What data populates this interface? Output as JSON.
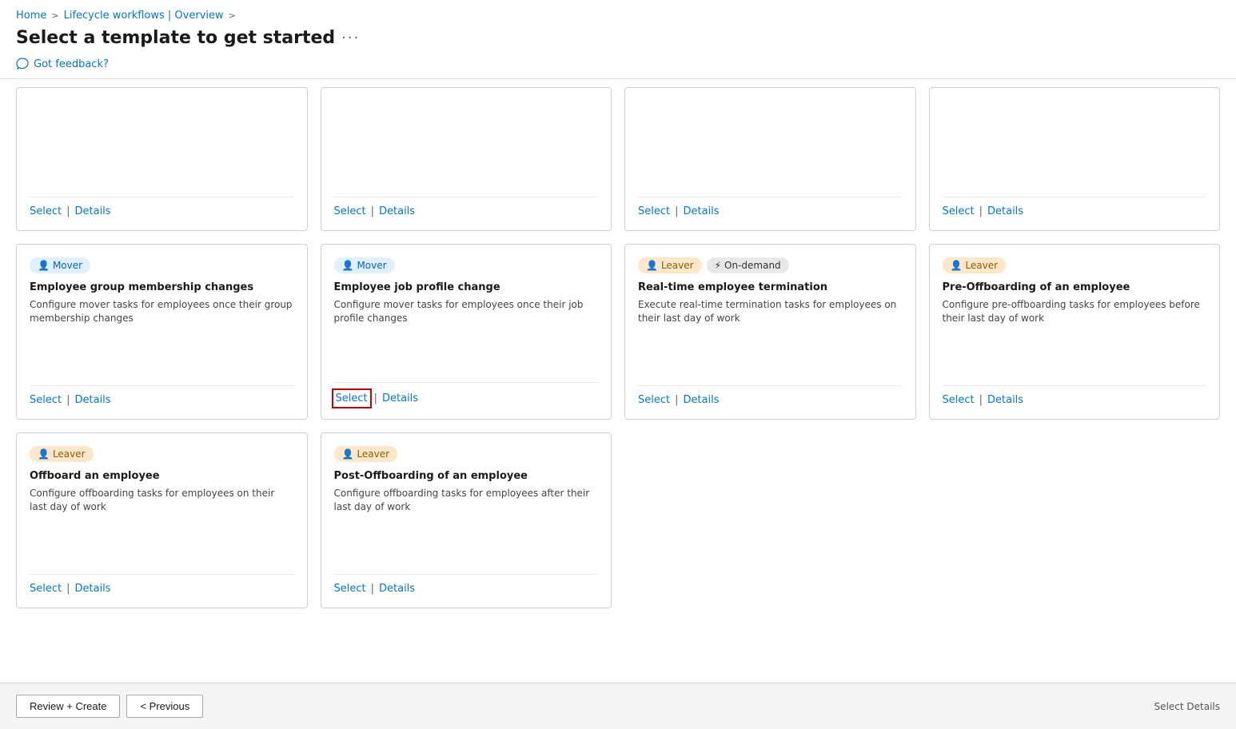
{
  "breadcrumb": {
    "home": "Home",
    "sep1": ">",
    "workflows": "Lifecycle workflows | Overview",
    "sep2": ">"
  },
  "page_title": "Select a template to get started",
  "page_title_more": "···",
  "feedback": "Got feedback?",
  "cards": [
    {
      "id": "card-1",
      "tags": [],
      "title": "",
      "description": "",
      "select_label": "Select",
      "details_label": "Details",
      "is_empty": true
    },
    {
      "id": "card-2",
      "tags": [],
      "title": "",
      "description": "",
      "select_label": "Select",
      "details_label": "Details",
      "is_empty": true
    },
    {
      "id": "card-3",
      "tags": [],
      "title": "",
      "description": "",
      "select_label": "Select",
      "details_label": "Details",
      "is_empty": true
    },
    {
      "id": "card-4",
      "tags": [],
      "title": "",
      "description": "",
      "select_label": "Select",
      "details_label": "Details",
      "is_empty": true
    },
    {
      "id": "card-5",
      "tags": [
        {
          "label": "Mover",
          "type": "mover"
        }
      ],
      "title": "Employee group membership changes",
      "description": "Configure mover tasks for employees once their group membership changes",
      "select_label": "Select",
      "details_label": "Details",
      "is_empty": false,
      "select_highlighted": false
    },
    {
      "id": "card-6",
      "tags": [
        {
          "label": "Mover",
          "type": "mover"
        }
      ],
      "title": "Employee job profile change",
      "description": "Configure mover tasks for employees once their job profile changes",
      "select_label": "Select",
      "details_label": "Details",
      "is_empty": false,
      "select_highlighted": true
    },
    {
      "id": "card-7",
      "tags": [
        {
          "label": "Leaver",
          "type": "leaver"
        },
        {
          "label": "On-demand",
          "type": "ondemand"
        }
      ],
      "title": "Real-time employee termination",
      "description": "Execute real-time termination tasks for employees on their last day of work",
      "select_label": "Select",
      "details_label": "Details",
      "is_empty": false,
      "select_highlighted": false
    },
    {
      "id": "card-8",
      "tags": [
        {
          "label": "Leaver",
          "type": "leaver"
        }
      ],
      "title": "Pre-Offboarding of an employee",
      "description": "Configure pre-offboarding tasks for employees before their last day of work",
      "select_label": "Select",
      "details_label": "Details",
      "is_empty": false,
      "select_highlighted": false
    },
    {
      "id": "card-9",
      "tags": [
        {
          "label": "Leaver",
          "type": "leaver"
        }
      ],
      "title": "Offboard an employee",
      "description": "Configure offboarding tasks for employees on their last day of work",
      "select_label": "Select",
      "details_label": "Details",
      "is_empty": false,
      "select_highlighted": false
    },
    {
      "id": "card-10",
      "tags": [
        {
          "label": "Leaver",
          "type": "leaver"
        }
      ],
      "title": "Post-Offboarding of an employee",
      "description": "Configure offboarding tasks for employees after their last day of work",
      "select_label": "Select",
      "details_label": "Details",
      "is_empty": false,
      "select_highlighted": false
    }
  ],
  "bottom_bar": {
    "review_create_label": "Review + Create",
    "previous_label": "< Previous",
    "step_info": "Select Details"
  }
}
